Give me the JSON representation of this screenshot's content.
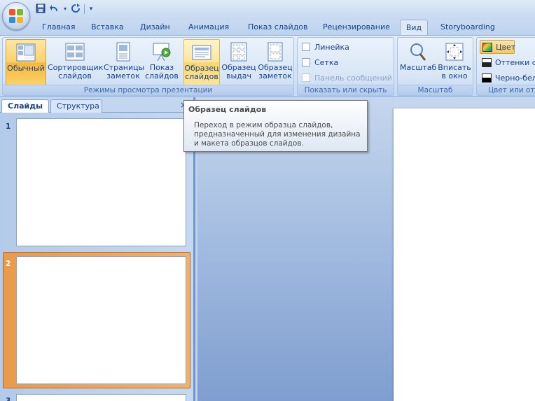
{
  "quick_access": {
    "save_icon": "save-icon",
    "undo_icon": "undo-icon",
    "redo_icon": "redo-icon",
    "customize_icon": "customize-icon"
  },
  "tabs": [
    {
      "label": "Главная"
    },
    {
      "label": "Вставка"
    },
    {
      "label": "Дизайн"
    },
    {
      "label": "Анимация"
    },
    {
      "label": "Показ слайдов"
    },
    {
      "label": "Рецензирование"
    },
    {
      "label": "Вид",
      "active": true
    },
    {
      "label": "Storyboarding"
    }
  ],
  "ribbon": {
    "views_group": {
      "label": "Режимы просмотра презентации",
      "buttons": [
        {
          "line1": "Обычный",
          "line2": "",
          "active": true
        },
        {
          "line1": "Сортировщик",
          "line2": "слайдов"
        },
        {
          "line1": "Страницы",
          "line2": "заметок"
        },
        {
          "line1": "Показ",
          "line2": "слайдов"
        },
        {
          "line1": "Образец",
          "line2": "слайдов",
          "hover": true
        },
        {
          "line1": "Образец",
          "line2": "выдач"
        },
        {
          "line1": "Образец",
          "line2": "заметок"
        }
      ]
    },
    "show_group": {
      "label": "Показать или скрыть",
      "items": [
        {
          "label": "Линейка",
          "enabled": true
        },
        {
          "label": "Сетка",
          "enabled": true
        },
        {
          "label": "Панель сообщений",
          "enabled": false
        }
      ]
    },
    "zoom_group": {
      "label": "Масштаб",
      "buttons": [
        {
          "line1": "Масштаб",
          "line2": ""
        },
        {
          "line1": "Вписать",
          "line2": "в окно"
        }
      ]
    },
    "color_group": {
      "label": "Цвет или отт",
      "items": [
        {
          "label": "Цвет",
          "active": true
        },
        {
          "label": "Оттенки се"
        },
        {
          "label": "Черно-бел"
        }
      ]
    }
  },
  "left_pane": {
    "tabs": [
      {
        "label": "Слайды",
        "active": true
      },
      {
        "label": "Структура"
      }
    ],
    "close_label": "×",
    "slides": [
      {
        "number": "1"
      },
      {
        "number": "2",
        "selected": true
      },
      {
        "number": "3"
      }
    ]
  },
  "tooltip": {
    "title": "Образец слайдов",
    "body": "Переход в режим образца слайдов, предназначенный для изменения дизайна и макета образцов слайдов."
  }
}
